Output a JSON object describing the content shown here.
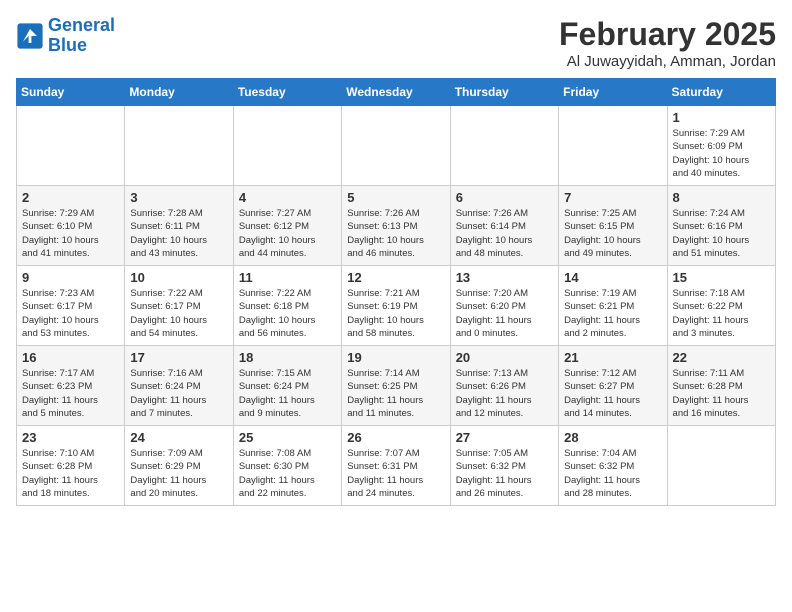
{
  "header": {
    "logo_line1": "General",
    "logo_line2": "Blue",
    "month": "February 2025",
    "location": "Al Juwayyidah, Amman, Jordan"
  },
  "days_of_week": [
    "Sunday",
    "Monday",
    "Tuesday",
    "Wednesday",
    "Thursday",
    "Friday",
    "Saturday"
  ],
  "weeks": [
    [
      {
        "day": "",
        "info": ""
      },
      {
        "day": "",
        "info": ""
      },
      {
        "day": "",
        "info": ""
      },
      {
        "day": "",
        "info": ""
      },
      {
        "day": "",
        "info": ""
      },
      {
        "day": "",
        "info": ""
      },
      {
        "day": "1",
        "info": "Sunrise: 7:29 AM\nSunset: 6:09 PM\nDaylight: 10 hours\nand 40 minutes."
      }
    ],
    [
      {
        "day": "2",
        "info": "Sunrise: 7:29 AM\nSunset: 6:10 PM\nDaylight: 10 hours\nand 41 minutes."
      },
      {
        "day": "3",
        "info": "Sunrise: 7:28 AM\nSunset: 6:11 PM\nDaylight: 10 hours\nand 43 minutes."
      },
      {
        "day": "4",
        "info": "Sunrise: 7:27 AM\nSunset: 6:12 PM\nDaylight: 10 hours\nand 44 minutes."
      },
      {
        "day": "5",
        "info": "Sunrise: 7:26 AM\nSunset: 6:13 PM\nDaylight: 10 hours\nand 46 minutes."
      },
      {
        "day": "6",
        "info": "Sunrise: 7:26 AM\nSunset: 6:14 PM\nDaylight: 10 hours\nand 48 minutes."
      },
      {
        "day": "7",
        "info": "Sunrise: 7:25 AM\nSunset: 6:15 PM\nDaylight: 10 hours\nand 49 minutes."
      },
      {
        "day": "8",
        "info": "Sunrise: 7:24 AM\nSunset: 6:16 PM\nDaylight: 10 hours\nand 51 minutes."
      }
    ],
    [
      {
        "day": "9",
        "info": "Sunrise: 7:23 AM\nSunset: 6:17 PM\nDaylight: 10 hours\nand 53 minutes."
      },
      {
        "day": "10",
        "info": "Sunrise: 7:22 AM\nSunset: 6:17 PM\nDaylight: 10 hours\nand 54 minutes."
      },
      {
        "day": "11",
        "info": "Sunrise: 7:22 AM\nSunset: 6:18 PM\nDaylight: 10 hours\nand 56 minutes."
      },
      {
        "day": "12",
        "info": "Sunrise: 7:21 AM\nSunset: 6:19 PM\nDaylight: 10 hours\nand 58 minutes."
      },
      {
        "day": "13",
        "info": "Sunrise: 7:20 AM\nSunset: 6:20 PM\nDaylight: 11 hours\nand 0 minutes."
      },
      {
        "day": "14",
        "info": "Sunrise: 7:19 AM\nSunset: 6:21 PM\nDaylight: 11 hours\nand 2 minutes."
      },
      {
        "day": "15",
        "info": "Sunrise: 7:18 AM\nSunset: 6:22 PM\nDaylight: 11 hours\nand 3 minutes."
      }
    ],
    [
      {
        "day": "16",
        "info": "Sunrise: 7:17 AM\nSunset: 6:23 PM\nDaylight: 11 hours\nand 5 minutes."
      },
      {
        "day": "17",
        "info": "Sunrise: 7:16 AM\nSunset: 6:24 PM\nDaylight: 11 hours\nand 7 minutes."
      },
      {
        "day": "18",
        "info": "Sunrise: 7:15 AM\nSunset: 6:24 PM\nDaylight: 11 hours\nand 9 minutes."
      },
      {
        "day": "19",
        "info": "Sunrise: 7:14 AM\nSunset: 6:25 PM\nDaylight: 11 hours\nand 11 minutes."
      },
      {
        "day": "20",
        "info": "Sunrise: 7:13 AM\nSunset: 6:26 PM\nDaylight: 11 hours\nand 12 minutes."
      },
      {
        "day": "21",
        "info": "Sunrise: 7:12 AM\nSunset: 6:27 PM\nDaylight: 11 hours\nand 14 minutes."
      },
      {
        "day": "22",
        "info": "Sunrise: 7:11 AM\nSunset: 6:28 PM\nDaylight: 11 hours\nand 16 minutes."
      }
    ],
    [
      {
        "day": "23",
        "info": "Sunrise: 7:10 AM\nSunset: 6:28 PM\nDaylight: 11 hours\nand 18 minutes."
      },
      {
        "day": "24",
        "info": "Sunrise: 7:09 AM\nSunset: 6:29 PM\nDaylight: 11 hours\nand 20 minutes."
      },
      {
        "day": "25",
        "info": "Sunrise: 7:08 AM\nSunset: 6:30 PM\nDaylight: 11 hours\nand 22 minutes."
      },
      {
        "day": "26",
        "info": "Sunrise: 7:07 AM\nSunset: 6:31 PM\nDaylight: 11 hours\nand 24 minutes."
      },
      {
        "day": "27",
        "info": "Sunrise: 7:05 AM\nSunset: 6:32 PM\nDaylight: 11 hours\nand 26 minutes."
      },
      {
        "day": "28",
        "info": "Sunrise: 7:04 AM\nSunset: 6:32 PM\nDaylight: 11 hours\nand 28 minutes."
      },
      {
        "day": "",
        "info": ""
      }
    ]
  ]
}
